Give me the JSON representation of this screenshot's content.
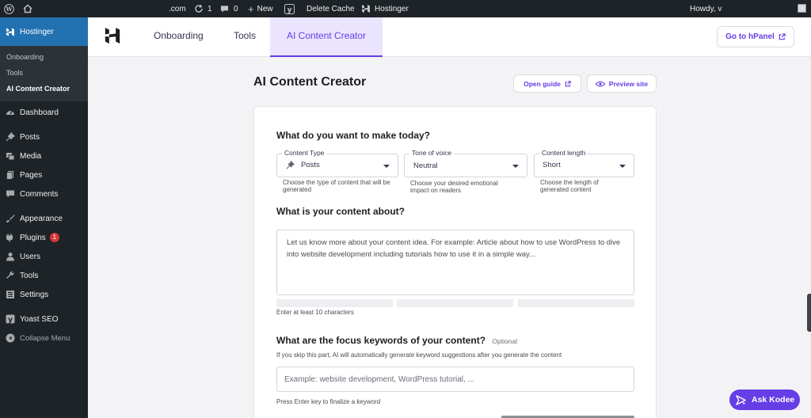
{
  "adminbar": {
    "site": ".com",
    "updates_count": "1",
    "comments_count": "0",
    "new_label": "New",
    "delete_cache_label": "Delete Cache",
    "hostinger_label": "Hostinger",
    "howdy": "Howdy, ᴠ"
  },
  "sidebar": {
    "hostinger_label": "Hostinger",
    "submenu": [
      "Onboarding",
      "Tools",
      "AI Content Creator"
    ],
    "items": [
      {
        "label": "Dashboard",
        "icon": "dashboard-icon"
      },
      {
        "label": "Posts",
        "icon": "pin-icon"
      },
      {
        "label": "Media",
        "icon": "media-icon"
      },
      {
        "label": "Pages",
        "icon": "pages-icon"
      },
      {
        "label": "Comments",
        "icon": "comments-icon"
      },
      {
        "label": "Appearance",
        "icon": "brush-icon"
      },
      {
        "label": "Plugins",
        "icon": "plug-icon",
        "badge": "1"
      },
      {
        "label": "Users",
        "icon": "users-icon"
      },
      {
        "label": "Tools",
        "icon": "wrench-icon"
      },
      {
        "label": "Settings",
        "icon": "settings-icon"
      },
      {
        "label": "Yoast SEO",
        "icon": "yoast-icon"
      },
      {
        "label": "Collapse Menu",
        "icon": "collapse-icon"
      }
    ]
  },
  "topnav": {
    "tabs": [
      "Onboarding",
      "Tools",
      "AI Content Creator"
    ],
    "hpanel_label": "Go to hPanel"
  },
  "page": {
    "title": "AI Content Creator",
    "open_guide_label": "Open guide",
    "preview_site_label": "Preview site"
  },
  "form": {
    "make_heading": "What do you want to make today?",
    "content_type": {
      "legend": "Content Type",
      "value": "Posts",
      "hint": "Choose the type of content that will be generated"
    },
    "tone": {
      "legend": "Tone of voice",
      "value": "Neutral",
      "hint": "Choose your desired emotional impact on readers"
    },
    "length": {
      "legend": "Content length",
      "value": "Short",
      "hint": "Choose the length of generated content"
    },
    "about_heading": "What is your content about?",
    "about_placeholder": "Let us know more about your content idea. For example: Article about how to use WordPress to dive into website development including tutorials how to use it in a simple way...",
    "about_hint": "Enter at least 10 characters",
    "keywords_heading": "What are the focus keywords of your content?",
    "keywords_optional": "Optional",
    "keywords_desc": "If you skip this part, AI will automatically generate keyword suggestions after you generate the content",
    "keywords_placeholder": "Example: website development, WordPress tutorial, ...",
    "keywords_hint": "Press Enter key to finalize a keyword"
  },
  "kodee": {
    "label": "Ask Kodee"
  },
  "colors": {
    "accent": "#673de6",
    "wp_dark": "#1d2327",
    "wp_blue": "#2271b1"
  }
}
